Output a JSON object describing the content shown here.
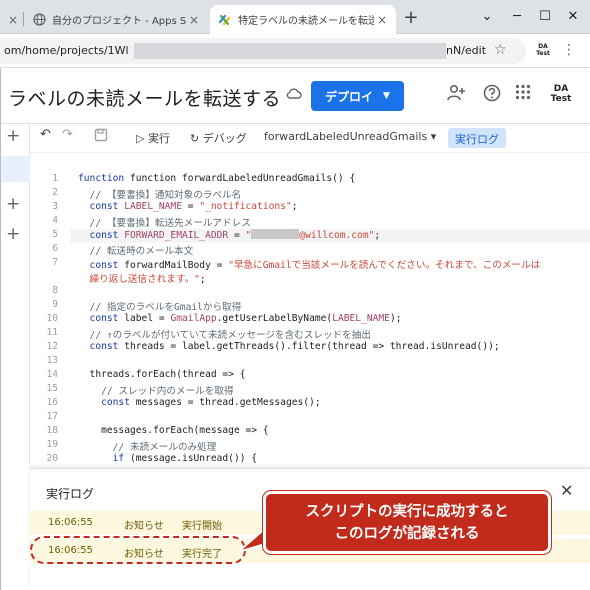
{
  "browser": {
    "tabs": [
      {
        "label": ""
      },
      {
        "label": "自分のプロジェクト - Apps Script"
      },
      {
        "label": "特定ラベルの未読メールを転送する"
      }
    ],
    "close_glyph": "×",
    "new_tab_glyph": "+",
    "window_controls": [
      "⌄",
      "─",
      "☐",
      "✕"
    ],
    "url_prefix": "om/home/projects/1Wl",
    "url_suffix": "nN/edit",
    "profile": {
      "line1": "DA",
      "line2": "Test"
    }
  },
  "app": {
    "project_title": "ラベルの未読メールを転送する",
    "deploy_label": "デプロイ",
    "deploy_caret": "▼",
    "profile": {
      "line1": "DA",
      "line2": "Test"
    }
  },
  "toolbar": {
    "run_label": "実行",
    "debug_label": "デバッグ",
    "function_select": "forwardLabeledUnreadGmails",
    "log_label": "実行ログ"
  },
  "code_lines": [
    {
      "n": "1"
    },
    {
      "n": "2"
    },
    {
      "n": "3"
    },
    {
      "n": "4"
    },
    {
      "n": "5"
    },
    {
      "n": "6"
    },
    {
      "n": "7"
    },
    {
      "n": "8"
    },
    {
      "n": "9"
    },
    {
      "n": "10"
    },
    {
      "n": "11"
    },
    {
      "n": "12"
    },
    {
      "n": "13"
    },
    {
      "n": "14"
    },
    {
      "n": "15"
    },
    {
      "n": "16"
    },
    {
      "n": "17"
    },
    {
      "n": "18"
    },
    {
      "n": "19"
    },
    {
      "n": "20"
    }
  ],
  "code": {
    "l1": "function forwardLabeledUnreadGmails() {",
    "l2": "  // 【要書換】通知対象のラベル名",
    "l3a": "  const ",
    "l3b": "LABEL_NAME",
    "l3c": " = ",
    "l3d": "\"_notifications\"",
    "l3e": ";",
    "l4": "  // 【要書換】転送先メールアドレス",
    "l5a": "  const ",
    "l5b": "FORWARD_EMAIL_ADDR",
    "l5c": " = ",
    "l5d": "\"",
    "l5e": "@willcom.com\"",
    "l5f": ";",
    "l6": "  // 転送時のメール本文",
    "l7a": "  const ",
    "l7b": "forwardMailBody = ",
    "l7c": "\"早急にGmailで当該メールを読んでください。それまで、このメールは",
    "l7d": "  繰り返し送信されます。\"",
    "l7e": ";",
    "l9": "  // 指定のラベルをGmailから取得",
    "l10a": "  const ",
    "l10b": "label = ",
    "l10c": "GmailApp",
    "l10d": ".getUserLabelByName(",
    "l10e": "LABEL_NAME",
    "l10f": ");",
    "l11": "  // ↑のラベルが付いていて未読メッセージを含むスレッドを抽出",
    "l12a": "  const ",
    "l12b": "threads = label.getThreads().filter(thread => thread.isUnread());",
    "l14": "  threads.forEach(thread => {",
    "l15": "    // スレッド内のメールを取得",
    "l16a": "    const ",
    "l16b": "messages = thread.getMessages();",
    "l18": "    messages.forEach(message => {",
    "l19": "      // 未読メールのみ処理",
    "l20a": "      if ",
    "l20b": "(message.isUnread()) {"
  },
  "log": {
    "title": "実行ログ",
    "close": "✕",
    "entries": [
      {
        "time": "16:06:55",
        "level": "お知らせ",
        "message": "実行開始"
      },
      {
        "time": "16:06:55",
        "level": "お知らせ",
        "message": "実行完了"
      }
    ]
  },
  "callout": {
    "line1": "スクリプトの実行に成功すると",
    "line2": "このログが記録される"
  },
  "colors": {
    "accent": "#1a73e8",
    "callout": "#c22a1c",
    "log_row": "#fef7e0"
  }
}
